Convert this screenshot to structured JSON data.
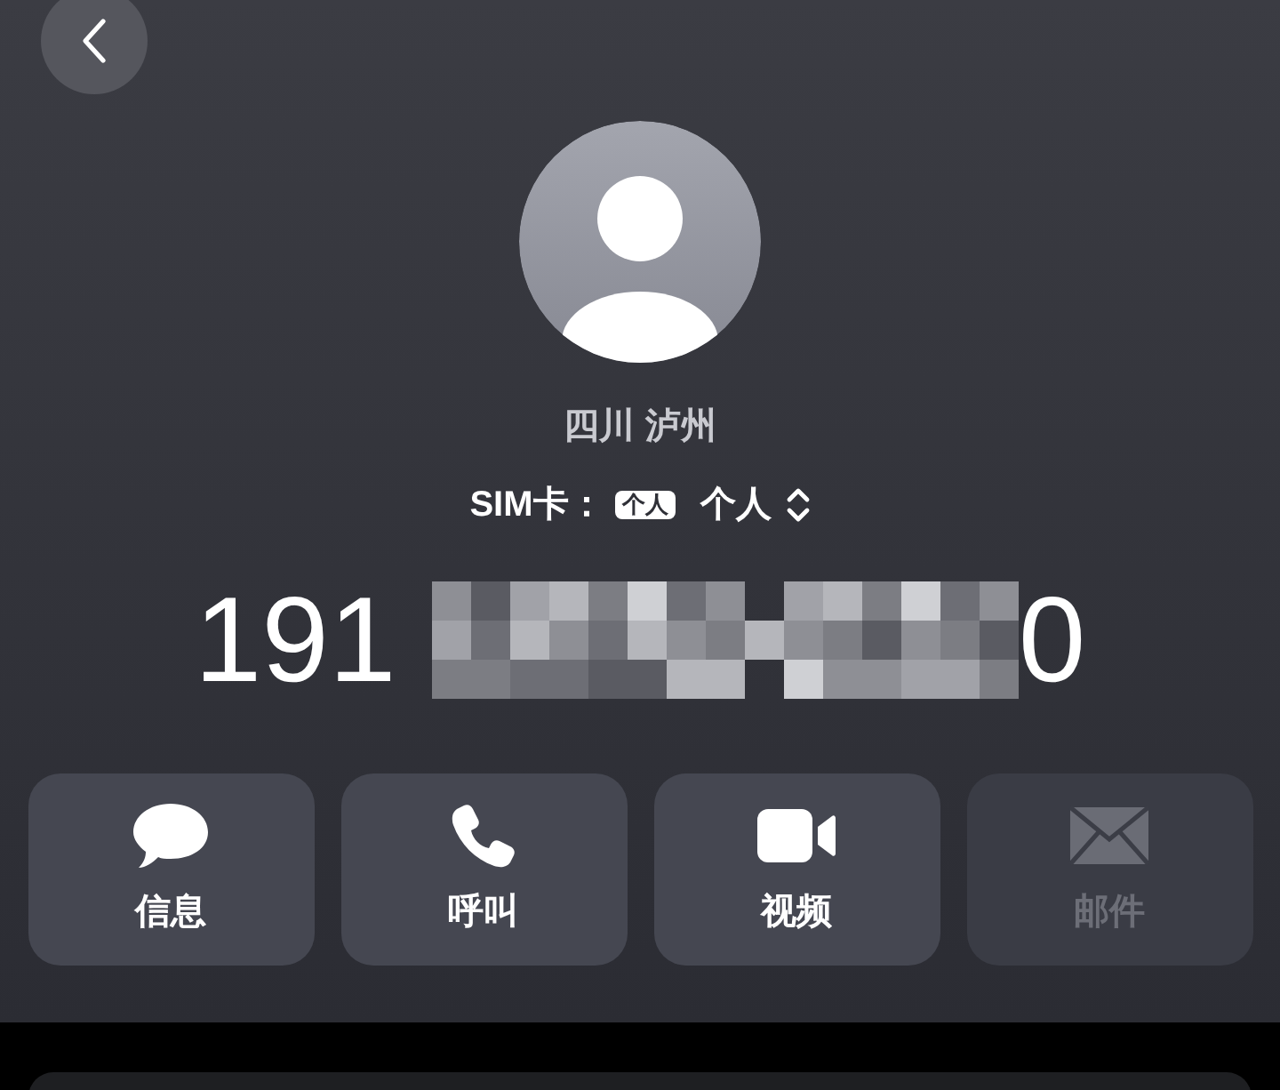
{
  "contact": {
    "location": "四川 泸州",
    "sim_label": "SIM卡：",
    "sim_badge": "个人",
    "sim_value": "个人",
    "number_start": "191",
    "number_end": "0"
  },
  "actions": [
    {
      "kind": "message",
      "label": "信息",
      "disabled": false
    },
    {
      "kind": "call",
      "label": "呼叫",
      "disabled": false
    },
    {
      "kind": "video",
      "label": "视频",
      "disabled": false
    },
    {
      "kind": "mail",
      "label": "邮件",
      "disabled": true
    }
  ]
}
